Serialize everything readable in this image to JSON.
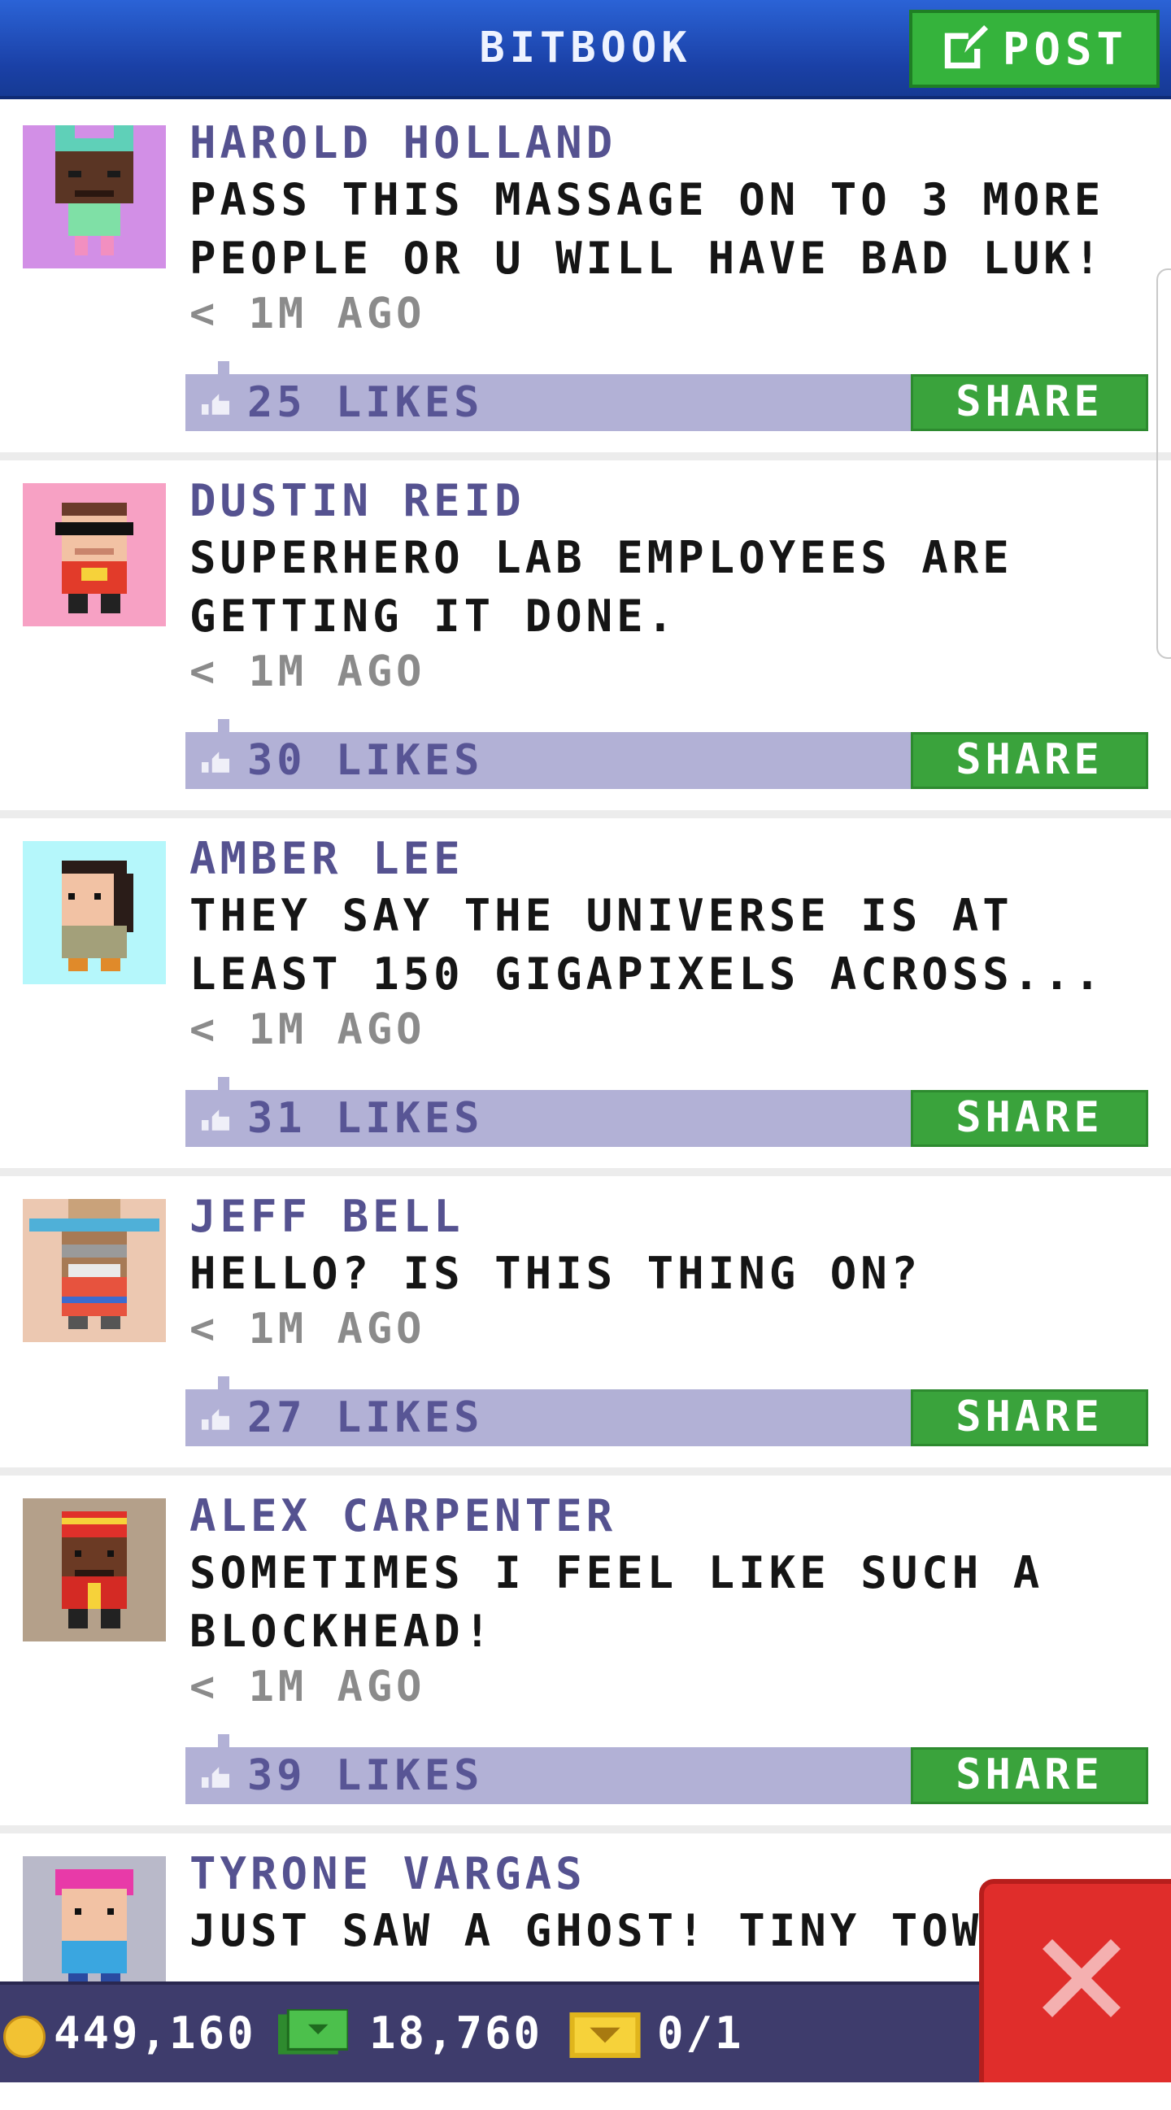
{
  "header": {
    "title": "BITBOOK",
    "post_label": "POST"
  },
  "posts": [
    {
      "author": "HAROLD HOLLAND",
      "message": "PASS THIS MASSAGE ON TO 3 MORE PEOPLE OR U WILL HAVE BAD LUK!",
      "time": "< 1M AGO",
      "likes": "25 LIKES",
      "share": "SHARE",
      "avatar_color": "#d28fe6"
    },
    {
      "author": "DUSTIN REID",
      "message": "SUPERHERO LAB EMPLOYEES ARE GETTING IT DONE.",
      "time": "< 1M AGO",
      "likes": "30 LIKES",
      "share": "SHARE",
      "avatar_color": "#f7a1c4"
    },
    {
      "author": "AMBER LEE",
      "message": "THEY SAY THE UNIVERSE IS AT LEAST 150 GIGAPIXELS ACROSS...",
      "time": "< 1M AGO",
      "likes": "31 LIKES",
      "share": "SHARE",
      "avatar_color": "#b5f7fb"
    },
    {
      "author": "JEFF BELL",
      "message": "HELLO? IS THIS THING ON?",
      "time": "< 1M AGO",
      "likes": "27 LIKES",
      "share": "SHARE",
      "avatar_color": "#ecc8b1"
    },
    {
      "author": "ALEX CARPENTER",
      "message": "SOMETIMES I FEEL LIKE SUCH A BLOCKHEAD!",
      "time": "< 1M AGO",
      "likes": "39 LIKES",
      "share": "SHARE",
      "avatar_color": "#b4a08a"
    },
    {
      "author": "TYRONE VARGAS",
      "message": "JUST SAW A GHOST! TINY TOWER",
      "avatar_color": "#b9b9c9"
    }
  ],
  "status": {
    "coins": "449,160",
    "bux": "18,760",
    "vip": "0/1"
  },
  "colors": {
    "header": "#1f49b5",
    "post_button": "#35b33c",
    "likes_bar": "#b2b1d6",
    "share_button": "#3aa33c",
    "close_button": "#e02d2b",
    "bottom_bar": "#3e3c6c"
  }
}
